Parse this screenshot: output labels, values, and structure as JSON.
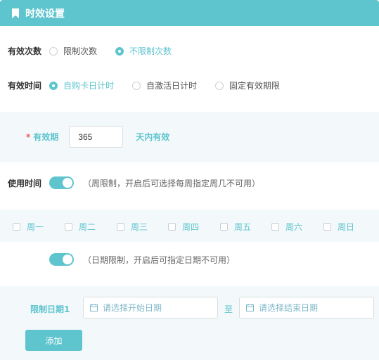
{
  "header": {
    "title": "时效设置",
    "icon": "bookmark-icon"
  },
  "validity_count": {
    "label": "有效次数",
    "options": [
      {
        "label": "限制次数",
        "checked": false
      },
      {
        "label": "不限制次数",
        "checked": true
      }
    ]
  },
  "validity_time": {
    "label": "有效时间",
    "options": [
      {
        "label": "自购卡日计时",
        "checked": true
      },
      {
        "label": "自激活日计时",
        "checked": false
      },
      {
        "label": "固定有效期限",
        "checked": false
      }
    ]
  },
  "validity_period": {
    "required_mark": "*",
    "label": "有效期",
    "value": "365",
    "suffix": "天内有效"
  },
  "usage_time": {
    "label": "使用时间",
    "toggle_on": true,
    "hint": "（周限制，开启后可选择每周指定周几不可用）"
  },
  "weekdays": [
    "周一",
    "周二",
    "周三",
    "周四",
    "周五",
    "周六",
    "周日"
  ],
  "date_limit": {
    "toggle_on": true,
    "hint": "（日期限制，开启后可指定日期不可用）",
    "row_label": "限制日期1",
    "start_placeholder": "请选择开始日期",
    "separator": "至",
    "end_placeholder": "请选择结束日期"
  },
  "add_button": {
    "label": "添加"
  },
  "colors": {
    "accent": "#5ec4ce",
    "panel": "#f3f9fb",
    "required": "#f05a5a"
  }
}
